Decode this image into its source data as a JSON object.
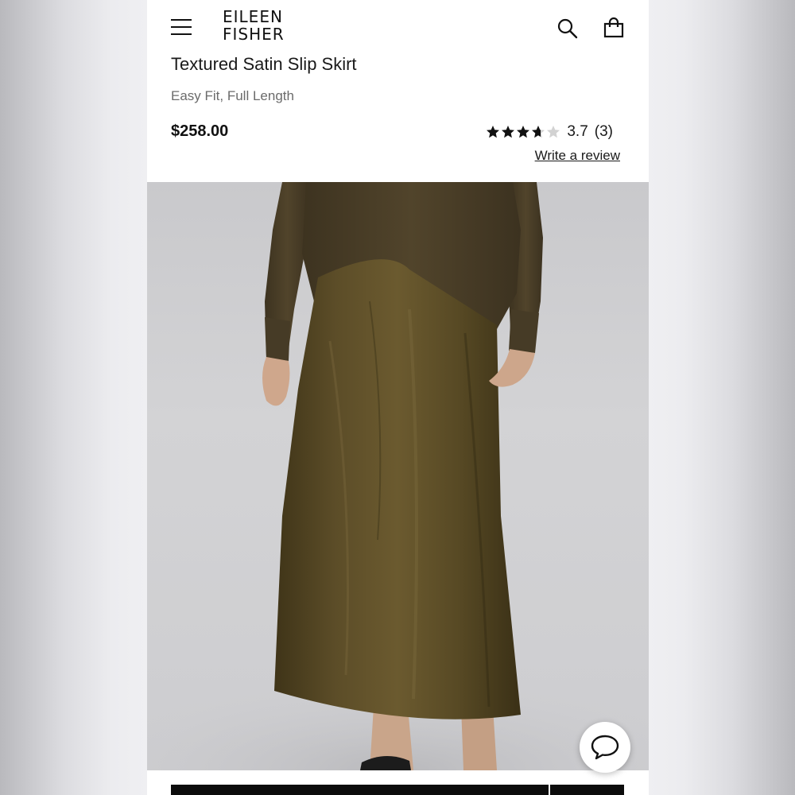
{
  "header": {
    "brand_line1": "EILEEN",
    "brand_line2": "FISHER",
    "menu_icon": "hamburger-menu-icon",
    "search_icon": "search-icon",
    "bag_icon": "shopping-bag-icon"
  },
  "product": {
    "title": "Textured Satin Slip Skirt",
    "subtitle": "Easy Fit, Full Length",
    "price": "$258.00",
    "rating": {
      "value": "3.7",
      "count": "(3)",
      "stars_filled": 3.7,
      "stars_total": 5
    },
    "review_link": "Write a review",
    "image_alt": "Model wearing olive textured satin slip skirt with olive sweater"
  },
  "chat": {
    "icon": "chat-bubble-icon"
  },
  "colors": {
    "text": "#1a1a1a",
    "muted": "#6b6b6b",
    "skirt": "#5a4b27",
    "sweater": "#4d4128",
    "background": "#efeff2"
  }
}
